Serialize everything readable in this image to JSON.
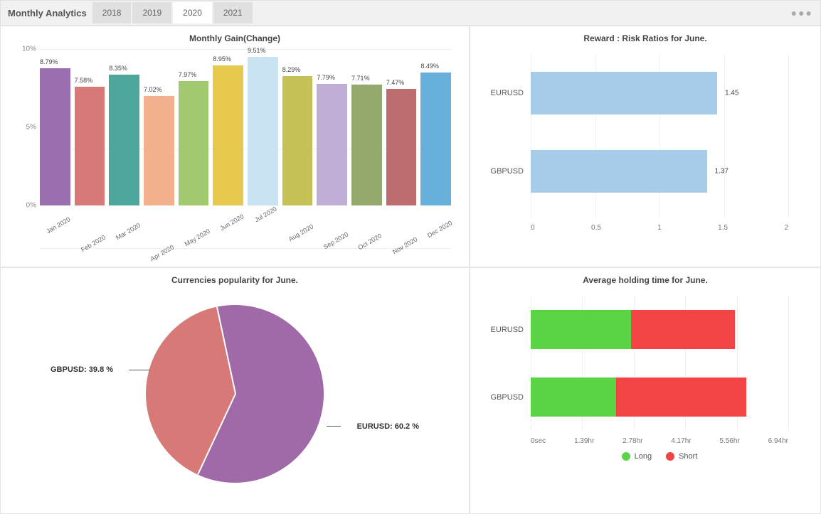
{
  "header": {
    "title": "Monthly Analytics",
    "tabs": [
      {
        "label": "2018",
        "active": false
      },
      {
        "label": "2019",
        "active": false
      },
      {
        "label": "2020",
        "active": true
      },
      {
        "label": "2021",
        "active": false
      }
    ],
    "more_icon": "more"
  },
  "chart_data": [
    {
      "id": "monthly_gain",
      "type": "bar",
      "title": "Monthly Gain(Change)",
      "ylabel": "",
      "ylim": [
        0,
        10
      ],
      "yticks": [
        "0%",
        "5%",
        "10%"
      ],
      "categories": [
        "Jan 2020",
        "Feb 2020",
        "Mar 2020",
        "Apr 2020",
        "May 2020",
        "Jun 2020",
        "Jul 2020",
        "Aug 2020",
        "Sep 2020",
        "Oct 2020",
        "Nov 2020",
        "Dec 2020"
      ],
      "values": [
        8.79,
        7.58,
        8.35,
        7.02,
        7.97,
        8.95,
        9.51,
        8.29,
        7.79,
        7.71,
        7.47,
        8.49
      ],
      "value_labels": [
        "8.79%",
        "7.58%",
        "8.35%",
        "7.02%",
        "7.97%",
        "8.95%",
        "9.51%",
        "8.29%",
        "7.79%",
        "7.71%",
        "7.47%",
        "8.49%"
      ],
      "colors": [
        "#9a6fb0",
        "#d77a77",
        "#4ea79b",
        "#f2b08c",
        "#a1c96e",
        "#e6c94a",
        "#c9e3f2",
        "#c6c157",
        "#bfaed6",
        "#93a86b",
        "#bd6d6d",
        "#68b0dc"
      ]
    },
    {
      "id": "reward_risk",
      "type": "bar",
      "orientation": "horizontal",
      "title": "Reward : Risk Ratios for June.",
      "categories": [
        "EURUSD",
        "GBPUSD"
      ],
      "values": [
        1.45,
        1.37
      ],
      "xlim": [
        0,
        2
      ],
      "xticks": [
        "0",
        "0.5",
        "1",
        "1.5",
        "2"
      ],
      "bar_color": "#a7cce9"
    },
    {
      "id": "currencies_popularity",
      "type": "pie",
      "title": "Currencies popularity for June.",
      "slices": [
        {
          "name": "EURUSD",
          "value": 60.2,
          "label": "EURUSD: 60.2 %",
          "color": "#a06aa9"
        },
        {
          "name": "GBPUSD",
          "value": 39.8,
          "label": "GBPUSD: 39.8 %",
          "color": "#d77a77"
        }
      ]
    },
    {
      "id": "holding_time",
      "type": "bar",
      "orientation": "horizontal",
      "stacked": true,
      "title": "Average holding time for June.",
      "categories": [
        "EURUSD",
        "GBPUSD"
      ],
      "series": [
        {
          "name": "Long",
          "color": "#5ad345",
          "values": [
            2.7,
            2.3
          ]
        },
        {
          "name": "Short",
          "color": "#f24444",
          "values": [
            2.8,
            3.5
          ]
        }
      ],
      "xlim": [
        0,
        6.94
      ],
      "xticks": [
        "0sec",
        "1.39hr",
        "2.78hr",
        "4.17hr",
        "5.56hr",
        "6.94hr"
      ],
      "legend": [
        "Long",
        "Short"
      ]
    }
  ]
}
